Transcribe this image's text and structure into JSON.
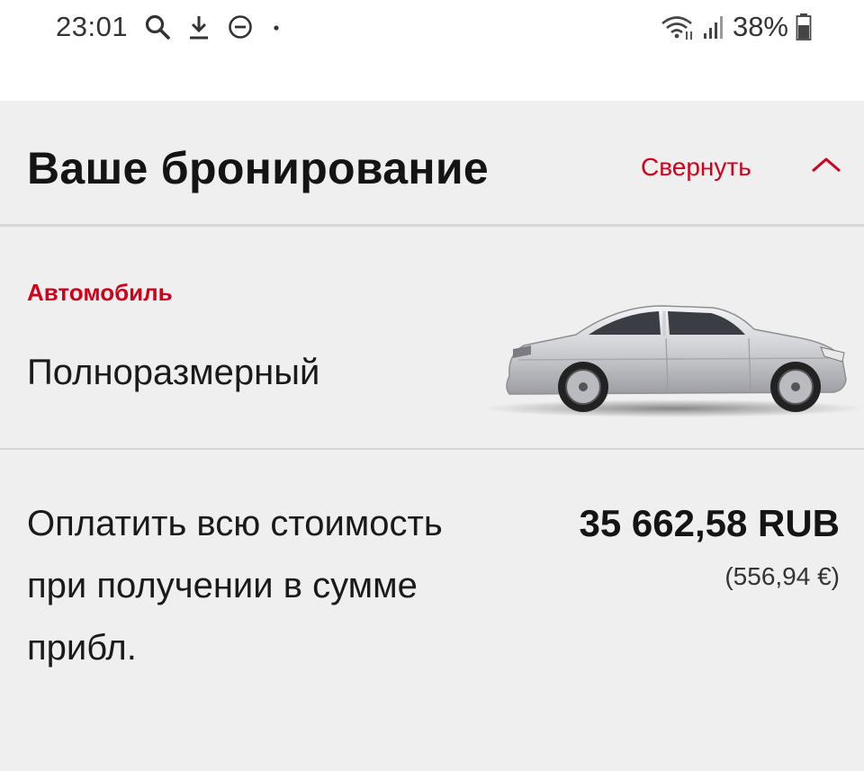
{
  "status_bar": {
    "time": "23:01",
    "icons_left": [
      "search-icon",
      "download-icon",
      "do-not-disturb-icon",
      "dot-icon"
    ],
    "icons_right": [
      "wifi-icon",
      "signal-icon",
      "battery-icon"
    ],
    "battery": "38%"
  },
  "header": {
    "title": "Ваше бронирование",
    "collapse_label": "Свернуть"
  },
  "car": {
    "label": "Автомобиль",
    "class": "Полноразмерный",
    "image": "silver-sedan-image"
  },
  "payment": {
    "text": "Оплатить всю стоимость при получении в сумме прибл.",
    "amount": "35 662,58 RUB",
    "amount_eur": "(556,94 €)"
  },
  "colors": {
    "accent": "#d0021b",
    "background": "#efefef",
    "divider": "#d6d6d6",
    "status_bar": "#ffffff"
  }
}
